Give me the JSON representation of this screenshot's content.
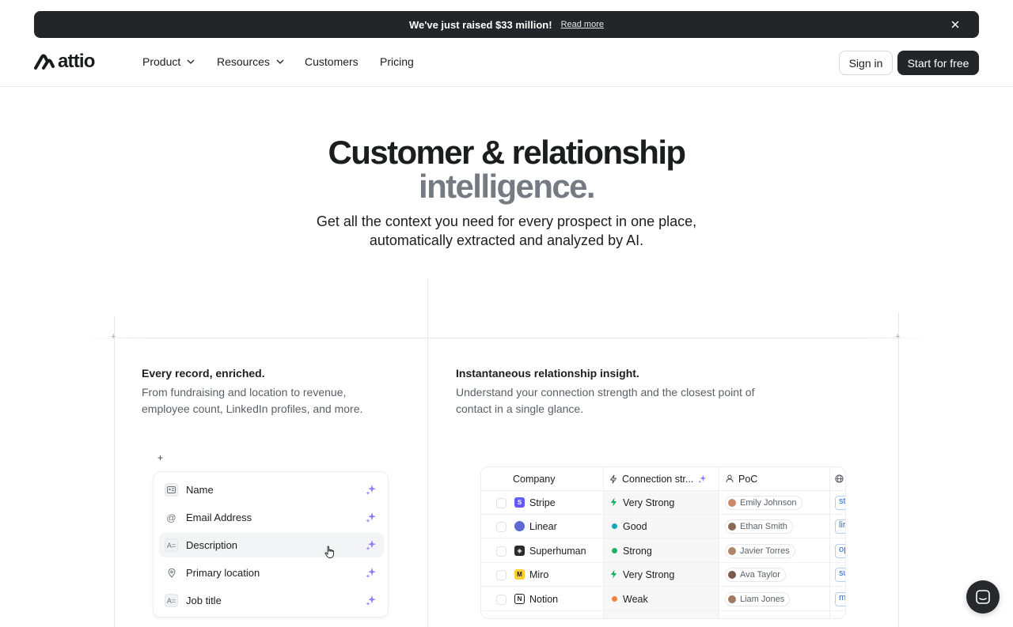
{
  "banner": {
    "message": "We've just raised $33 million!",
    "link": "Read more"
  },
  "brand": {
    "name": "attio"
  },
  "nav": {
    "items": [
      {
        "label": "Product",
        "has_dropdown": true
      },
      {
        "label": "Resources",
        "has_dropdown": true
      },
      {
        "label": "Customers",
        "has_dropdown": false
      },
      {
        "label": "Pricing",
        "has_dropdown": false
      }
    ],
    "sign_in": "Sign in",
    "start": "Start for free"
  },
  "hero": {
    "title_line1": "Customer & relationship",
    "title_line2": "intelligence.",
    "subtitle_line1": "Get all the context you need for every prospect in one place,",
    "subtitle_line2": "automatically extracted and analyzed by AI."
  },
  "features": [
    {
      "title": "Every record, enriched.",
      "desc_line1": "From fundraising and location to revenue,",
      "desc_line2": "employee count, LinkedIn profiles, and more."
    },
    {
      "title": "Instantaneous relationship insight.",
      "desc_line1": "Understand your connection strength and the closest point of",
      "desc_line2": "contact in a single glance."
    }
  ],
  "attributes": {
    "add_symbol": "+",
    "items": [
      {
        "label": "Name",
        "icon": "id-card-icon"
      },
      {
        "label": "Email Address",
        "icon": "at-icon"
      },
      {
        "label": "Description",
        "icon": "text-icon"
      },
      {
        "label": "Primary location",
        "icon": "location-pin-icon"
      },
      {
        "label": "Job title",
        "icon": "text-icon"
      }
    ]
  },
  "table": {
    "headers": {
      "company": "Company",
      "connection": "Connection str...",
      "poc": "PoC"
    },
    "rows": [
      {
        "company": "Stripe",
        "logo_color": "#635bff",
        "strength": "Very Strong",
        "strength_marker": "bolt",
        "strength_color": "#16b364",
        "poc": "Emily Johnson",
        "url": "st"
      },
      {
        "company": "Linear",
        "logo_color": "#5e6ad2",
        "strength": "Good",
        "strength_marker": "dot",
        "strength_color": "#14a8b8",
        "poc": "Ethan Smith",
        "url": "lir"
      },
      {
        "company": "Superhuman",
        "logo_color": "#2a2b2e",
        "strength": "Strong",
        "strength_marker": "dot",
        "strength_color": "#20b26b",
        "poc": "Javier Torres",
        "url": "op"
      },
      {
        "company": "Miro",
        "logo_color": "#ffd02f",
        "strength": "Very Strong",
        "strength_marker": "bolt",
        "strength_color": "#16b364",
        "poc": "Ava Taylor",
        "url": "su"
      },
      {
        "company": "Notion",
        "logo_color": "#ffffff",
        "strength": "Weak",
        "strength_marker": "dot",
        "strength_color": "#f5803e",
        "poc": "Liam Jones",
        "url": "m"
      }
    ]
  }
}
